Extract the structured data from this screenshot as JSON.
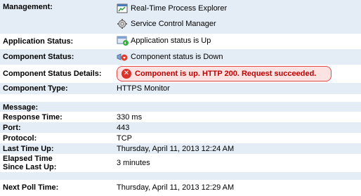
{
  "management": {
    "label": "Management:",
    "links": [
      {
        "text": "Real-Time Process Explorer",
        "icon": "process-explorer-icon"
      },
      {
        "text": "Service Control Manager",
        "icon": "gear-icon"
      }
    ]
  },
  "app_status": {
    "label": "Application Status:",
    "value": "Application status is Up"
  },
  "component_status": {
    "label": "Component Status:",
    "value": "Component status is Down"
  },
  "component_details": {
    "label": "Component Status Details:",
    "value": "Component is up. HTTP 200. Request succeeded."
  },
  "component_type": {
    "label": "Component Type:",
    "value": "HTTPS Monitor"
  },
  "message": {
    "label": "Message:"
  },
  "response_time": {
    "label": "Response Time:",
    "value": "330 ms"
  },
  "port": {
    "label": "Port:",
    "value": "443"
  },
  "protocol": {
    "label": "Protocol:",
    "value": "TCP"
  },
  "last_time_up": {
    "label": "Last Time Up:",
    "value": "Thursday, April 11, 2013 12:24 AM"
  },
  "elapsed": {
    "label_line1": "Elapsed Time",
    "label_line2": "Since Last Up:",
    "value": "3 minutes"
  },
  "next_poll": {
    "label": "Next Poll Time:",
    "value": "Thursday, April 11, 2013 12:29 AM"
  },
  "colors": {
    "row_shade": "#e4edf5",
    "error_text": "#c00000",
    "error_bg": "#fde2e2",
    "error_border": "#e24a4a"
  }
}
